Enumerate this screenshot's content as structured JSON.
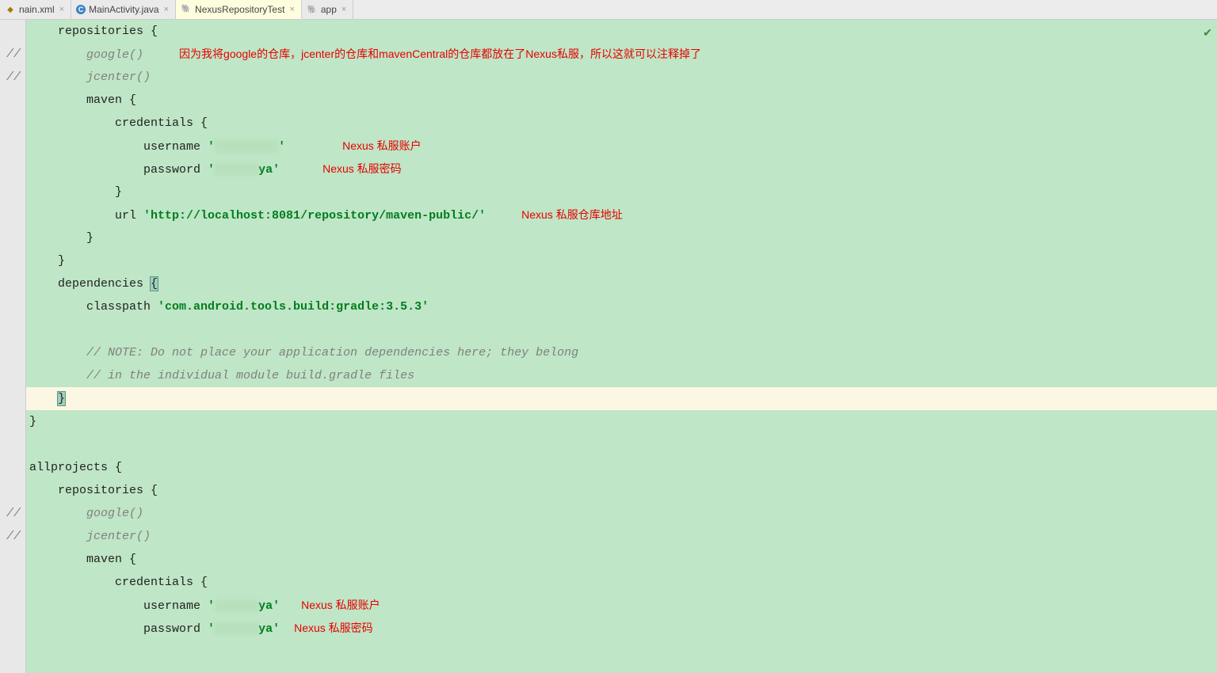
{
  "tabs": [
    {
      "label": "nain.xml",
      "iconClass": "xml",
      "iconText": "◆",
      "active": false
    },
    {
      "label": "MainActivity.java",
      "iconClass": "java",
      "iconText": "C",
      "active": false
    },
    {
      "label": "NexusRepositoryTest",
      "iconClass": "gradle",
      "iconText": "🐘",
      "active": true
    },
    {
      "label": "app",
      "iconClass": "gradle",
      "iconText": "🐘",
      "active": false
    }
  ],
  "closeGlyph": "×",
  "checkmark": "✔",
  "code": {
    "repos_open": "    repositories {",
    "google_cmt": "        google()",
    "jcenter_cmt": "        jcenter()",
    "maven_open": "        maven {",
    "cred_open": "            credentials {",
    "username": "                username ",
    "password": "                password ",
    "pw_str_a": "'",
    "pw_str_b": "ya'",
    "cred_close": "            }",
    "url_pre": "            url ",
    "url_str": "'http://localhost:8081/repository/maven-public/'",
    "maven_close": "        }",
    "repos_close": "    }",
    "deps_open": "    dependencies ",
    "deps_brace": "{",
    "classpath": "        classpath ",
    "classpath_str": "'com.android.tools.build:gradle:3.5.3'",
    "blank": "",
    "note1": "        // NOTE: Do not place your application dependencies here; they belong",
    "note2": "        // in the individual module build.gradle files",
    "deps_close_pre": "    ",
    "deps_close_brace": "}",
    "outer_close": "}",
    "allprojects": "allprojects {",
    "pw2_str_a": "'",
    "pw2_str_b": "ya'"
  },
  "annotations": {
    "comment_repos": "因为我将google的仓库，jcenter的仓库和mavenCentral的仓库都放在了Nexus私服，所以这就可以注释掉了",
    "username": "Nexus 私服账户",
    "password": "Nexus 私服密码",
    "url": "Nexus 私服仓库地址"
  },
  "gutterMark": "//"
}
